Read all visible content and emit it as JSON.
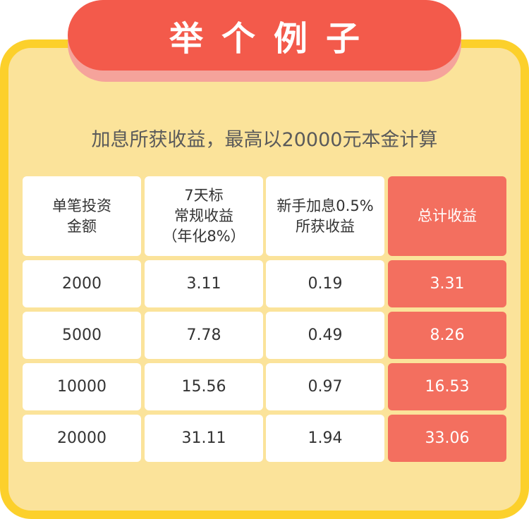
{
  "banner": {
    "title": "举个例子"
  },
  "subtitle": "加息所获收益，最高以20000元本金计算",
  "table": {
    "headers": [
      "单笔投资\n金额",
      "7天标\n常规收益\n（年化8%）",
      "新手加息0.5%\n所获收益",
      "总计收益"
    ],
    "rows": [
      [
        "2000",
        "3.11",
        "0.19",
        "3.31"
      ],
      [
        "5000",
        "7.78",
        "0.49",
        "8.26"
      ],
      [
        "10000",
        "15.56",
        "0.97",
        "16.53"
      ],
      [
        "20000",
        "31.11",
        "1.94",
        "33.06"
      ]
    ]
  },
  "colors": {
    "card_background": "#fbe39a",
    "card_border": "#fcd02b",
    "banner": "#f35a4b",
    "highlight_column": "#f36f5f"
  }
}
